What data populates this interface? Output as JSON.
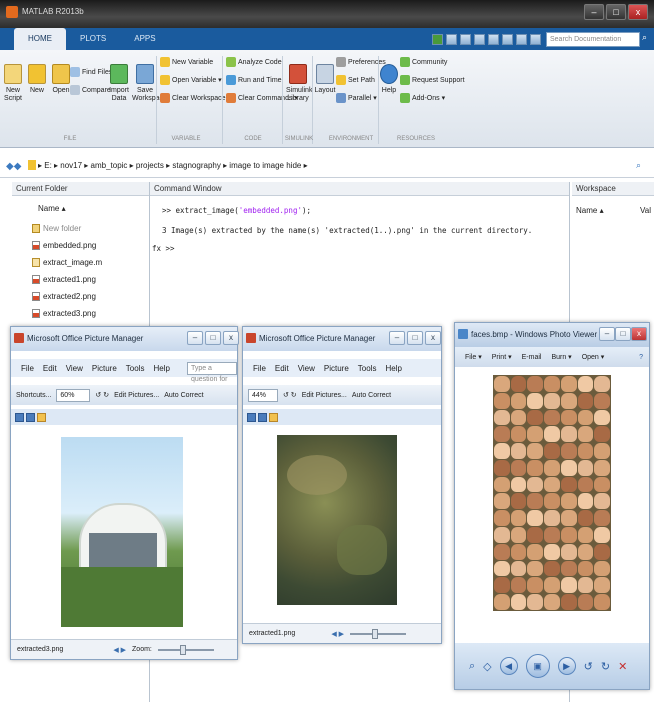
{
  "matlab": {
    "title": "MATLAB R2013b",
    "tabs": [
      "HOME",
      "PLOTS",
      "APPS"
    ],
    "search_placeholder": "Search Documentation",
    "ribbon": {
      "new_script": "New Script",
      "new": "New",
      "open": "Open",
      "find_files": "Find Files",
      "compare": "Compare",
      "import_data": "Import Data",
      "save_workspace": "Save Workspace",
      "new_variable": "New Variable",
      "open_variable": "Open Variable ▾",
      "clear_workspace": "Clear Workspace ▾",
      "analyze_code": "Analyze Code",
      "run_and_time": "Run and Time",
      "clear_commands": "Clear Commands ▾",
      "simulink_library": "Simulink Library",
      "layout": "Layout",
      "preferences": "Preferences",
      "set_path": "Set Path",
      "parallel": "Parallel ▾",
      "help": "Help",
      "community": "Community",
      "request_support": "Request Support",
      "add_ons": "Add-Ons ▾",
      "groups": [
        "FILE",
        "VARIABLE",
        "CODE",
        "SIMULINK",
        "ENVIRONMENT",
        "RESOURCES"
      ]
    },
    "path": "▸ E: ▸ nov17 ▸ amb_topic ▸ projects ▸ stagnography ▸ image to image hide ▸",
    "current_folder": {
      "header": "Current Folder",
      "name_col": "Name ▴",
      "files": [
        "New folder",
        "embedded.png",
        "extract_image.m",
        "extracted1.png",
        "extracted2.png",
        "extracted3.png"
      ]
    },
    "command_window": {
      "header": "Command Window",
      "line1_prompt": ">> ",
      "line1_cmd": "extract_image(",
      "line1_str": "'embedded.png'",
      "line1_end": ");",
      "line2": "3 Image(s) extracted by the name(s) 'extracted(1..).png' in the current directory.",
      "prompt": "fx >>"
    },
    "workspace": {
      "header": "Workspace",
      "name_col": "Name ▴",
      "value_col": "Val"
    }
  },
  "pm1": {
    "title": "Microsoft Office Picture Manager",
    "menu": [
      "File",
      "Edit",
      "View",
      "Picture",
      "Tools",
      "Help"
    ],
    "ask": "Type a question for help",
    "shortcuts": "Shortcuts...",
    "zoom": "60%",
    "edit_pictures": "Edit Pictures...",
    "auto_correct": "Auto Correct",
    "filename": "extracted3.png",
    "zoom_label": "Zoom:"
  },
  "pm2": {
    "title": "Microsoft Office Picture Manager",
    "menu": [
      "File",
      "Edit",
      "View",
      "Picture",
      "Tools",
      "Help"
    ],
    "zoom": "44%",
    "edit_pictures": "Edit Pictures...",
    "auto_correct": "Auto Correct",
    "filename": "extracted1.png"
  },
  "pv": {
    "title": "faces.bmp - Windows Photo Viewer",
    "menu": [
      "File ▾",
      "Print ▾",
      "E-mail",
      "Burn ▾",
      "Open ▾"
    ]
  },
  "colors": {
    "accent": "#1a5b9e",
    "prompt_string": "#a020f0"
  }
}
